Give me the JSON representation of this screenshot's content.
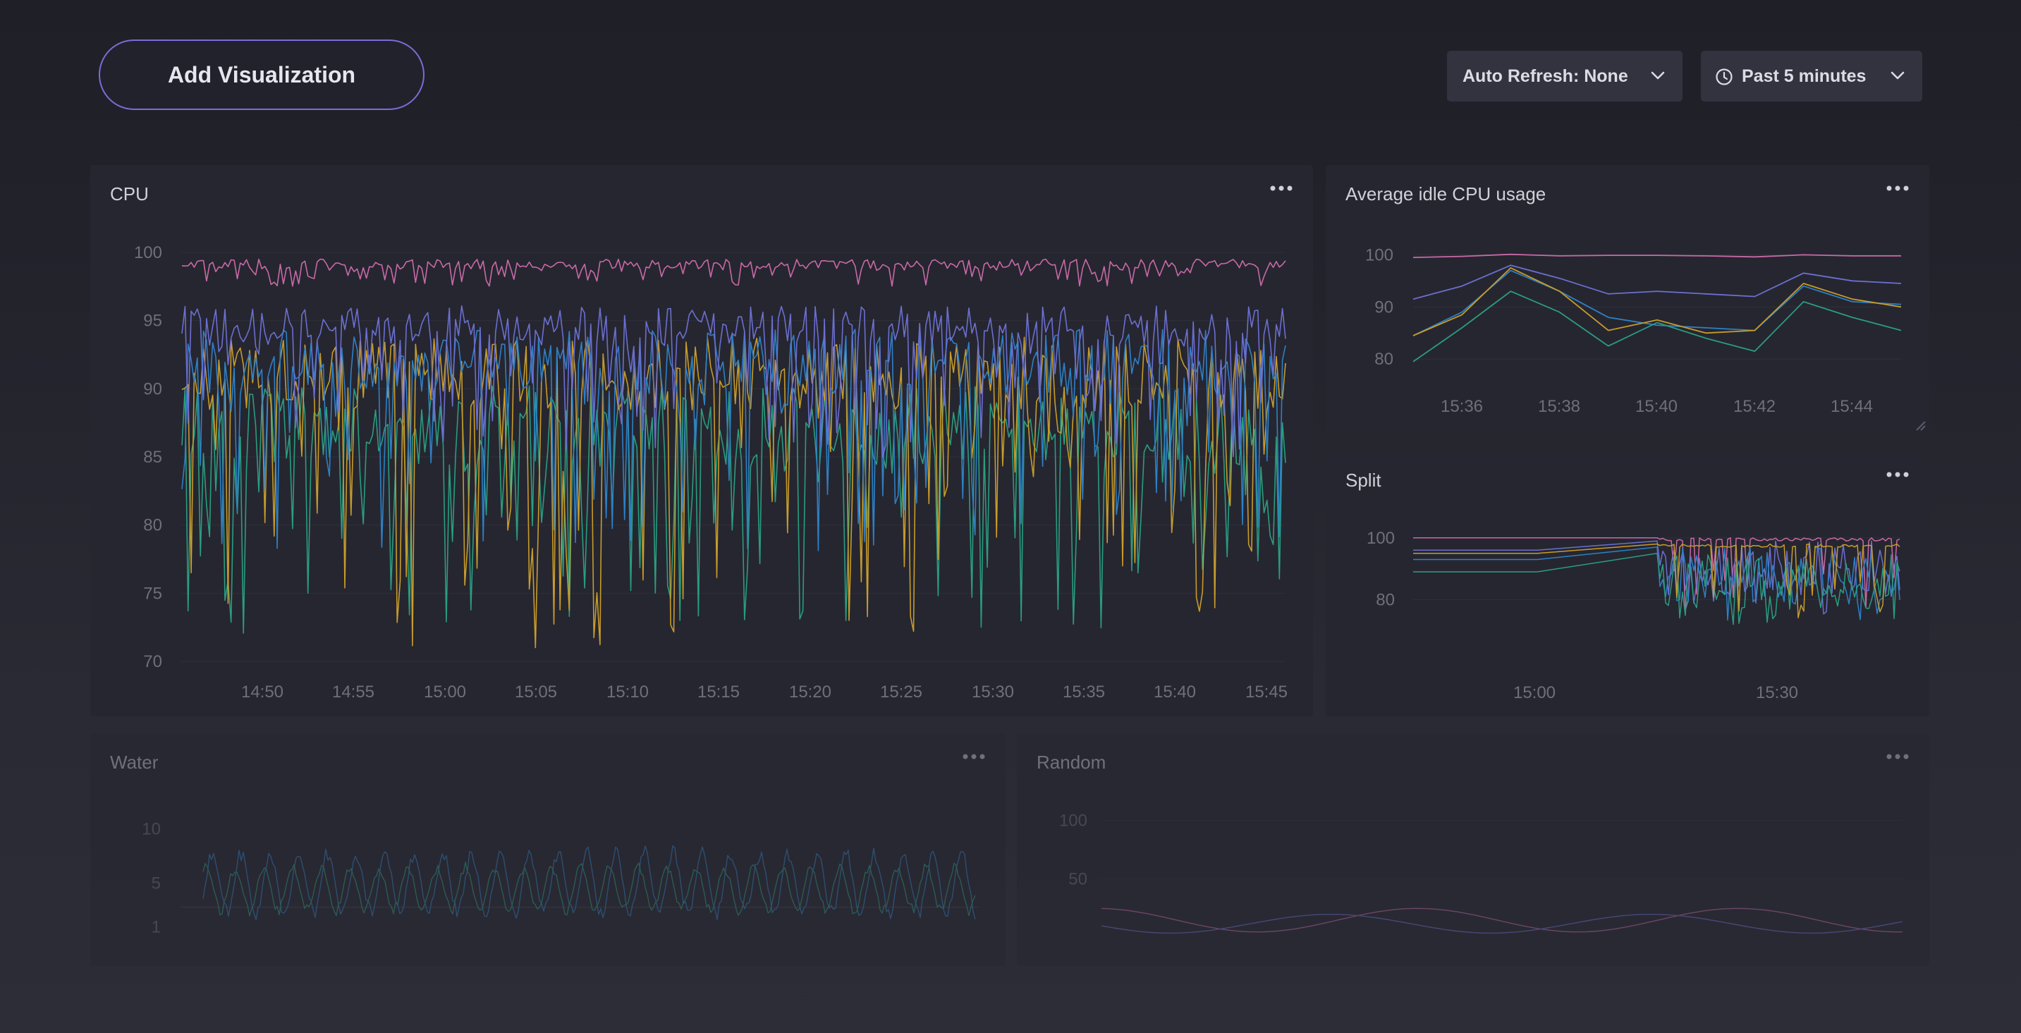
{
  "toolbar": {
    "add_visualization_label": "Add Visualization",
    "auto_refresh_label": "Auto Refresh: None",
    "time_range_label": "Past 5 minutes"
  },
  "colors": {
    "accent": "#7b6cd9",
    "series": [
      "#c86aa7",
      "#6b6fd0",
      "#2e80c5",
      "#c79c2b",
      "#2a9d7f",
      "#c85a5a"
    ]
  },
  "panels": {
    "cpu": {
      "title": "CPU",
      "chart_data": {
        "type": "line",
        "title": "CPU",
        "x_tick_labels": [
          "14:50",
          "14:55",
          "15:00",
          "15:05",
          "15:10",
          "15:15",
          "15:20",
          "15:25",
          "15:30",
          "15:35",
          "15:40",
          "15:45"
        ],
        "y_ticks": [
          100,
          95,
          90,
          85,
          80,
          75,
          70
        ],
        "ylim": [
          70,
          100
        ],
        "grid": true,
        "series": [
          {
            "color": "#c86aa7",
            "mean": 99.0,
            "spread": 1.2,
            "min": 97.5
          },
          {
            "color": "#6b6fd0",
            "mean": 94.0,
            "spread": 5.0,
            "min": 85.0
          },
          {
            "color": "#2e80c5",
            "mean": 91.0,
            "spread": 8.0,
            "min": 78.0
          },
          {
            "color": "#c79c2b",
            "mean": 90.0,
            "spread": 9.0,
            "min": 71.0
          },
          {
            "color": "#2a9d7f",
            "mean": 86.0,
            "spread": 10.0,
            "min": 72.0
          }
        ]
      }
    },
    "avg_idle": {
      "title": "Average idle CPU usage",
      "chart_data": {
        "type": "line",
        "title": "Average idle CPU usage",
        "x": [
          "15:35",
          "15:36",
          "15:37",
          "15:38",
          "15:39",
          "15:40",
          "15:41",
          "15:42",
          "15:43",
          "15:44",
          "15:45"
        ],
        "x_tick_labels": [
          "15:36",
          "15:38",
          "15:40",
          "15:42",
          "15:44"
        ],
        "y_ticks": [
          100,
          90,
          80
        ],
        "ylim": [
          78,
          101
        ],
        "grid": true,
        "series": [
          {
            "color": "#c86aa7",
            "values": [
              99.5,
              99.7,
              100.1,
              99.8,
              99.9,
              99.9,
              99.8,
              99.6,
              100.0,
              99.8,
              99.8
            ]
          },
          {
            "color": "#6b6fd0",
            "values": [
              91.5,
              94,
              98,
              95.5,
              92.5,
              93,
              92.5,
              92,
              96.5,
              95,
              94.5
            ]
          },
          {
            "color": "#2e80c5",
            "values": [
              84.5,
              89,
              97,
              93,
              88,
              86.5,
              86,
              85.5,
              94,
              91,
              90.5
            ]
          },
          {
            "color": "#c79c2b",
            "values": [
              84.5,
              88.5,
              97.5,
              93,
              85.5,
              87.5,
              85,
              85.5,
              94.5,
              91.5,
              90
            ]
          },
          {
            "color": "#2a9d7f",
            "values": [
              79.5,
              86,
              93,
              89,
              82.5,
              87,
              84,
              81.5,
              91,
              88,
              85.5
            ]
          }
        ]
      }
    },
    "split": {
      "title": "Split",
      "chart_data": {
        "type": "line",
        "title": "Split",
        "x_tick_labels": [
          "15:00",
          "15:30"
        ],
        "y_ticks": [
          100,
          80
        ],
        "ylim": [
          71,
          102
        ],
        "grid": true,
        "series": [
          {
            "color": "#c86aa7",
            "start": 100,
            "end": 100
          },
          {
            "color": "#6b6fd0",
            "start": 96,
            "end": 99
          },
          {
            "color": "#2e80c5",
            "start": 93,
            "end": 97
          },
          {
            "color": "#2a9d7f",
            "start": 89,
            "end": 95
          },
          {
            "color": "#c79c2b",
            "start": 95,
            "end": 98
          }
        ]
      }
    },
    "water": {
      "title": "Water",
      "chart_data": {
        "type": "line",
        "title": "Water",
        "y_ticks": [
          10,
          5,
          1
        ],
        "ylim": [
          0,
          11
        ],
        "series": [
          {
            "color": "#2e80c5",
            "mean": 5,
            "amplitude": 3.5
          },
          {
            "color": "#2a9d7f",
            "mean": 4.5,
            "amplitude": 2.5
          }
        ]
      }
    },
    "random": {
      "title": "Random",
      "chart_data": {
        "type": "line",
        "title": "Random",
        "y_ticks": [
          100,
          50
        ],
        "ylim": [
          0,
          120
        ],
        "grid": true,
        "series": [
          {
            "color": "#c86aa7",
            "mean": 15,
            "amplitude": 10
          },
          {
            "color": "#6b6fd0",
            "mean": 12,
            "amplitude": 8
          }
        ]
      }
    }
  }
}
